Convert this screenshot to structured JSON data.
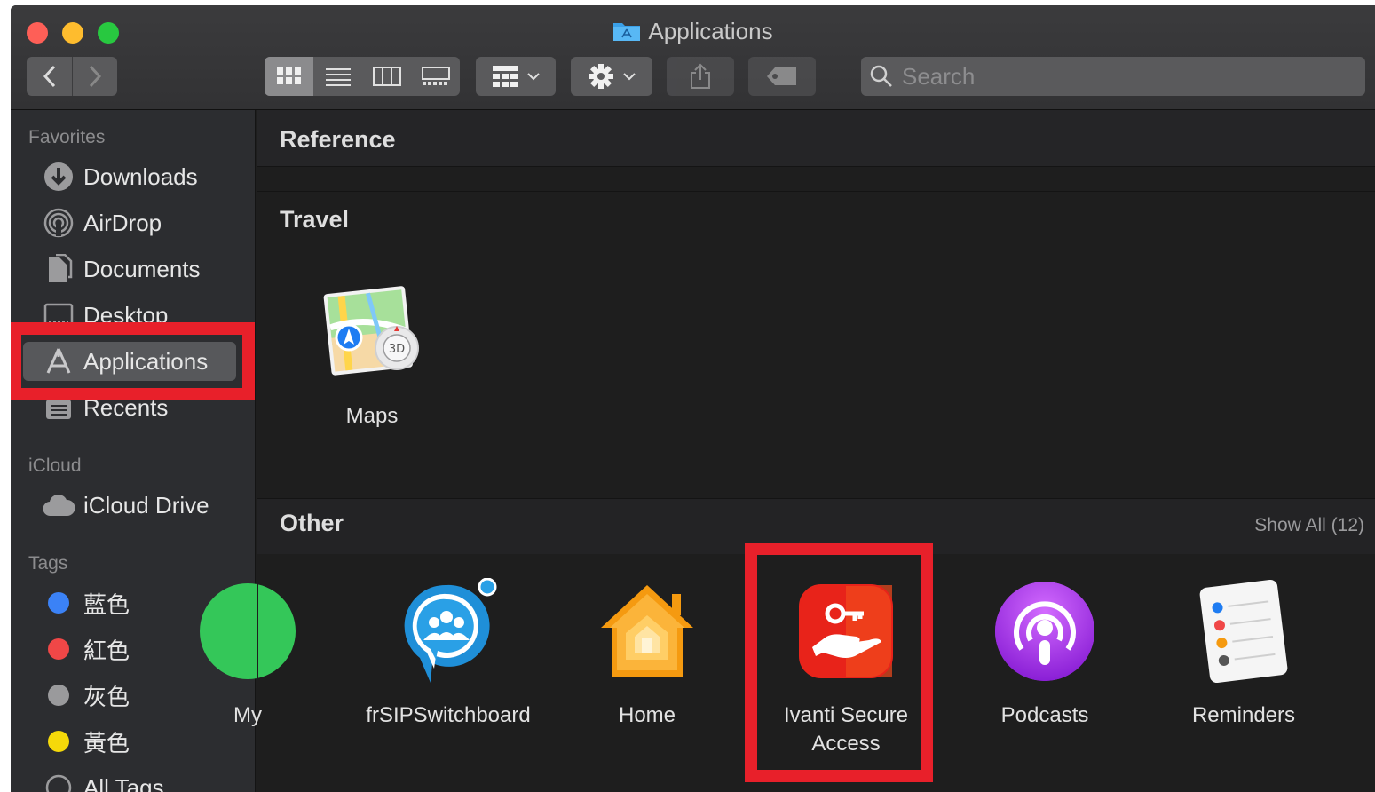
{
  "window": {
    "title": "Applications"
  },
  "toolbar": {
    "back_icon": "chevron-left-icon",
    "forward_icon": "chevron-right-icon",
    "view_modes": [
      "icon-view",
      "list-view",
      "column-view",
      "gallery-view"
    ],
    "search_placeholder": "Search"
  },
  "sidebar": {
    "favorites_label": "Favorites",
    "favorites": [
      {
        "label": "Downloads",
        "icon": "download-icon"
      },
      {
        "label": "AirDrop",
        "icon": "airdrop-icon"
      },
      {
        "label": "Documents",
        "icon": "documents-icon"
      },
      {
        "label": "Desktop",
        "icon": "desktop-icon"
      },
      {
        "label": "Applications",
        "icon": "applications-icon"
      },
      {
        "label": "Recents",
        "icon": "recents-icon"
      }
    ],
    "icloud_label": "iCloud",
    "icloud": [
      {
        "label": "iCloud Drive",
        "icon": "cloud-icon"
      }
    ],
    "tags_label": "Tags",
    "tags": [
      {
        "label": "藍色",
        "color": "#3b82f6"
      },
      {
        "label": "紅色",
        "color": "#f04747"
      },
      {
        "label": "灰色",
        "color": "#9a9a9c"
      },
      {
        "label": "黃色",
        "color": "#f5d90a"
      },
      {
        "label": "All Tags",
        "color": ""
      }
    ]
  },
  "main": {
    "sections": [
      {
        "title": "Reference"
      },
      {
        "title": "Travel",
        "apps": [
          {
            "label": "Maps"
          }
        ]
      },
      {
        "title": "Other",
        "show_all": "Show All (12)",
        "apps": [
          {
            "label": "My"
          },
          {
            "label": "frSIPSwitchboard"
          },
          {
            "label": "Home"
          },
          {
            "label_line1": "Ivanti Secure",
            "label_line2": "Access"
          },
          {
            "label": "Podcasts"
          },
          {
            "label": "Reminders"
          }
        ]
      }
    ]
  },
  "colors": {
    "highlight": "#e8202a",
    "accent": "#1e90ff"
  }
}
